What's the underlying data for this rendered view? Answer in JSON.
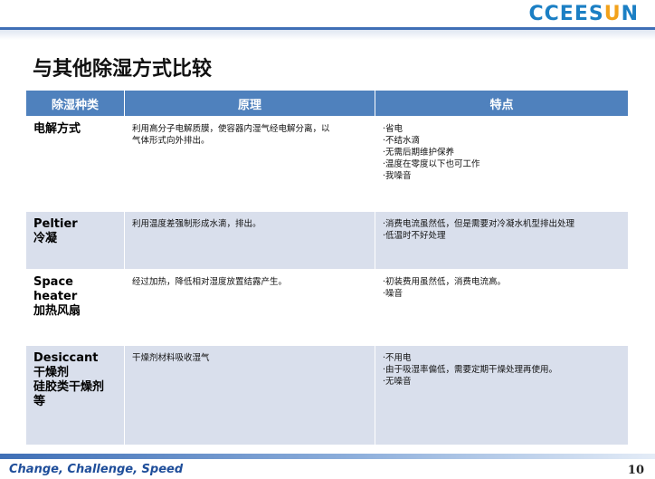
{
  "logo": {
    "main": "CCEES",
    "accent_u": "U",
    "tail": "N"
  },
  "title": "与其他除湿方式比较",
  "table": {
    "headers": [
      "除湿种类",
      "原理",
      "特点"
    ],
    "rows": [
      {
        "name": [
          "电解方式"
        ],
        "principle": [
          "利用高分子电解质膜，使容器内湿气经电解分离，以",
          "气体形式向外排出。"
        ],
        "features": [
          "·省电",
          "·不结水滴",
          "·无需后期维护保养",
          "·温度在零度以下也可工作",
          "·我噪音"
        ]
      },
      {
        "name": [
          "Peltier",
          "冷凝"
        ],
        "principle": [
          "利用温度差强制形成水滴，排出。"
        ],
        "features": [
          "·消费电流虽然低，但是需要对冷凝水机型排出处理",
          "·低温时不好处理"
        ]
      },
      {
        "name": [
          "Space",
          "heater",
          "加热风扇"
        ],
        "principle": [
          "经过加热，降低相对湿度放置结露产生。"
        ],
        "features": [
          "·初装费用虽然低，消费电流高。",
          "·噪音"
        ]
      },
      {
        "name": [
          "Desiccant",
          "干燥剂",
          "硅胶类干燥剂",
          "等"
        ],
        "principle": [
          "干燥剂材料吸收湿气"
        ],
        "features": [
          "·不用电",
          "·由于吸湿率偏低，需要定期干燥处理再使用。",
          "·无噪音"
        ]
      }
    ]
  },
  "footer": {
    "tagline": "Change, Challenge, Speed",
    "page_number": "10"
  },
  "colors": {
    "header_bg": "#4f81bd",
    "stripe": "#d9dfec",
    "logo_blue": "#1b7fc4",
    "logo_orange": "#f2a21b"
  }
}
